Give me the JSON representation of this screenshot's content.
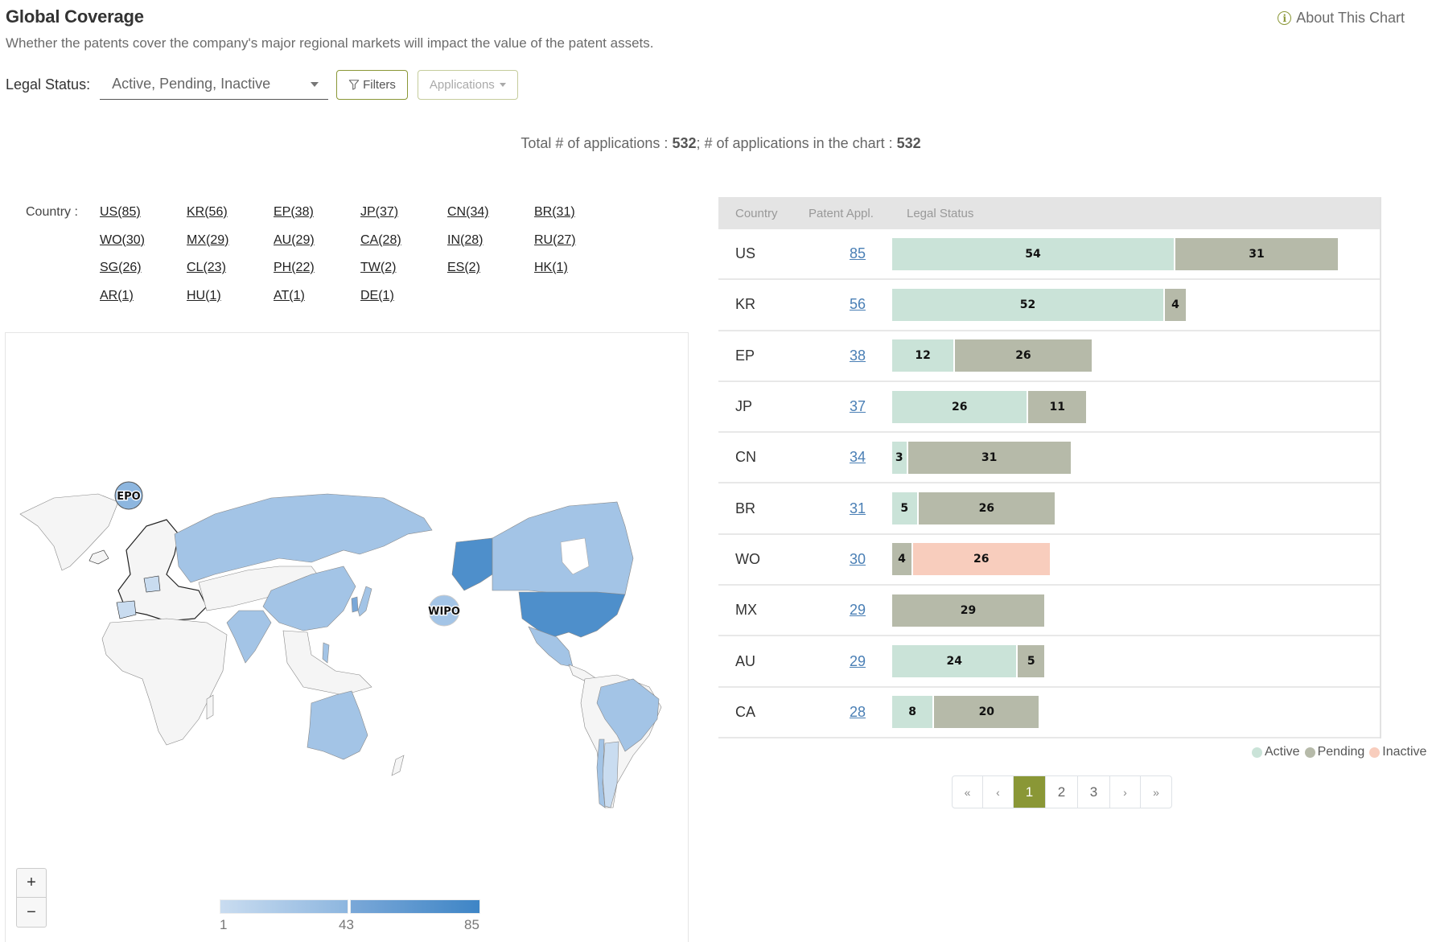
{
  "header": {
    "title": "Global Coverage",
    "subtitle": "Whether the patents cover the company's major regional markets will impact the value of the patent assets.",
    "about_label": "About This Chart",
    "about_icon": "info-icon"
  },
  "toolbar": {
    "legal_status_label": "Legal Status:",
    "legal_status_value": "Active, Pending, Inactive",
    "filters_label": "Filters",
    "filters_icon": "funnel-icon",
    "applications_label": "Applications"
  },
  "totals": {
    "prefix": "Total # of applications : ",
    "total": "532",
    "middle": "; # of applications in the chart : ",
    "in_chart": "532"
  },
  "countries": {
    "label": "Country :",
    "items": [
      "US(85)",
      "KR(56)",
      "EP(38)",
      "JP(37)",
      "CN(34)",
      "BR(31)",
      "WO(30)",
      "MX(29)",
      "AU(29)",
      "CA(28)",
      "IN(28)",
      "RU(27)",
      "SG(26)",
      "CL(23)",
      "PH(22)",
      "TW(2)",
      "ES(2)",
      "HK(1)",
      "AR(1)",
      "HU(1)",
      "AT(1)",
      "DE(1)"
    ]
  },
  "map": {
    "bubbles": [
      "EPO",
      "WIPO"
    ],
    "zoom_in": "+",
    "zoom_out": "−",
    "scale": {
      "min": "1",
      "mid": "43",
      "max": "85"
    },
    "colors": {
      "none": "#f5f5f5",
      "low": "#c9dcf0",
      "mid": "#a3c4e6",
      "high": "#4e8fcb"
    }
  },
  "table": {
    "headers": [
      "Country",
      "Patent Appl.",
      "Legal Status"
    ],
    "max_value": 85,
    "rows": [
      {
        "country": "US",
        "count": "85",
        "segments": [
          {
            "status": "active",
            "value": 54
          },
          {
            "status": "pending",
            "value": 31
          }
        ]
      },
      {
        "country": "KR",
        "count": "56",
        "segments": [
          {
            "status": "active",
            "value": 52
          },
          {
            "status": "pending",
            "value": 4
          }
        ]
      },
      {
        "country": "EP",
        "count": "38",
        "segments": [
          {
            "status": "active",
            "value": 12
          },
          {
            "status": "pending",
            "value": 26
          }
        ]
      },
      {
        "country": "JP",
        "count": "37",
        "segments": [
          {
            "status": "active",
            "value": 26
          },
          {
            "status": "pending",
            "value": 11
          }
        ]
      },
      {
        "country": "CN",
        "count": "34",
        "segments": [
          {
            "status": "active",
            "value": 3
          },
          {
            "status": "pending",
            "value": 31
          }
        ]
      },
      {
        "country": "BR",
        "count": "31",
        "segments": [
          {
            "status": "active",
            "value": 5
          },
          {
            "status": "pending",
            "value": 26
          }
        ]
      },
      {
        "country": "WO",
        "count": "30",
        "segments": [
          {
            "status": "pending",
            "value": 4
          },
          {
            "status": "inactive",
            "value": 26
          }
        ]
      },
      {
        "country": "MX",
        "count": "29",
        "segments": [
          {
            "status": "pending",
            "value": 29
          }
        ]
      },
      {
        "country": "AU",
        "count": "29",
        "segments": [
          {
            "status": "active",
            "value": 24
          },
          {
            "status": "pending",
            "value": 5
          }
        ]
      },
      {
        "country": "CA",
        "count": "28",
        "segments": [
          {
            "status": "active",
            "value": 8
          },
          {
            "status": "pending",
            "value": 20
          }
        ]
      }
    ]
  },
  "legend": [
    {
      "label": "Active",
      "color": "#cae3d8"
    },
    {
      "label": "Pending",
      "color": "#b6baa9"
    },
    {
      "label": "Inactive",
      "color": "#f8cdbd"
    }
  ],
  "pagination": {
    "first": "«",
    "prev": "‹",
    "pages": [
      "1",
      "2",
      "3"
    ],
    "current": "1",
    "next": "›",
    "last": "»"
  }
}
